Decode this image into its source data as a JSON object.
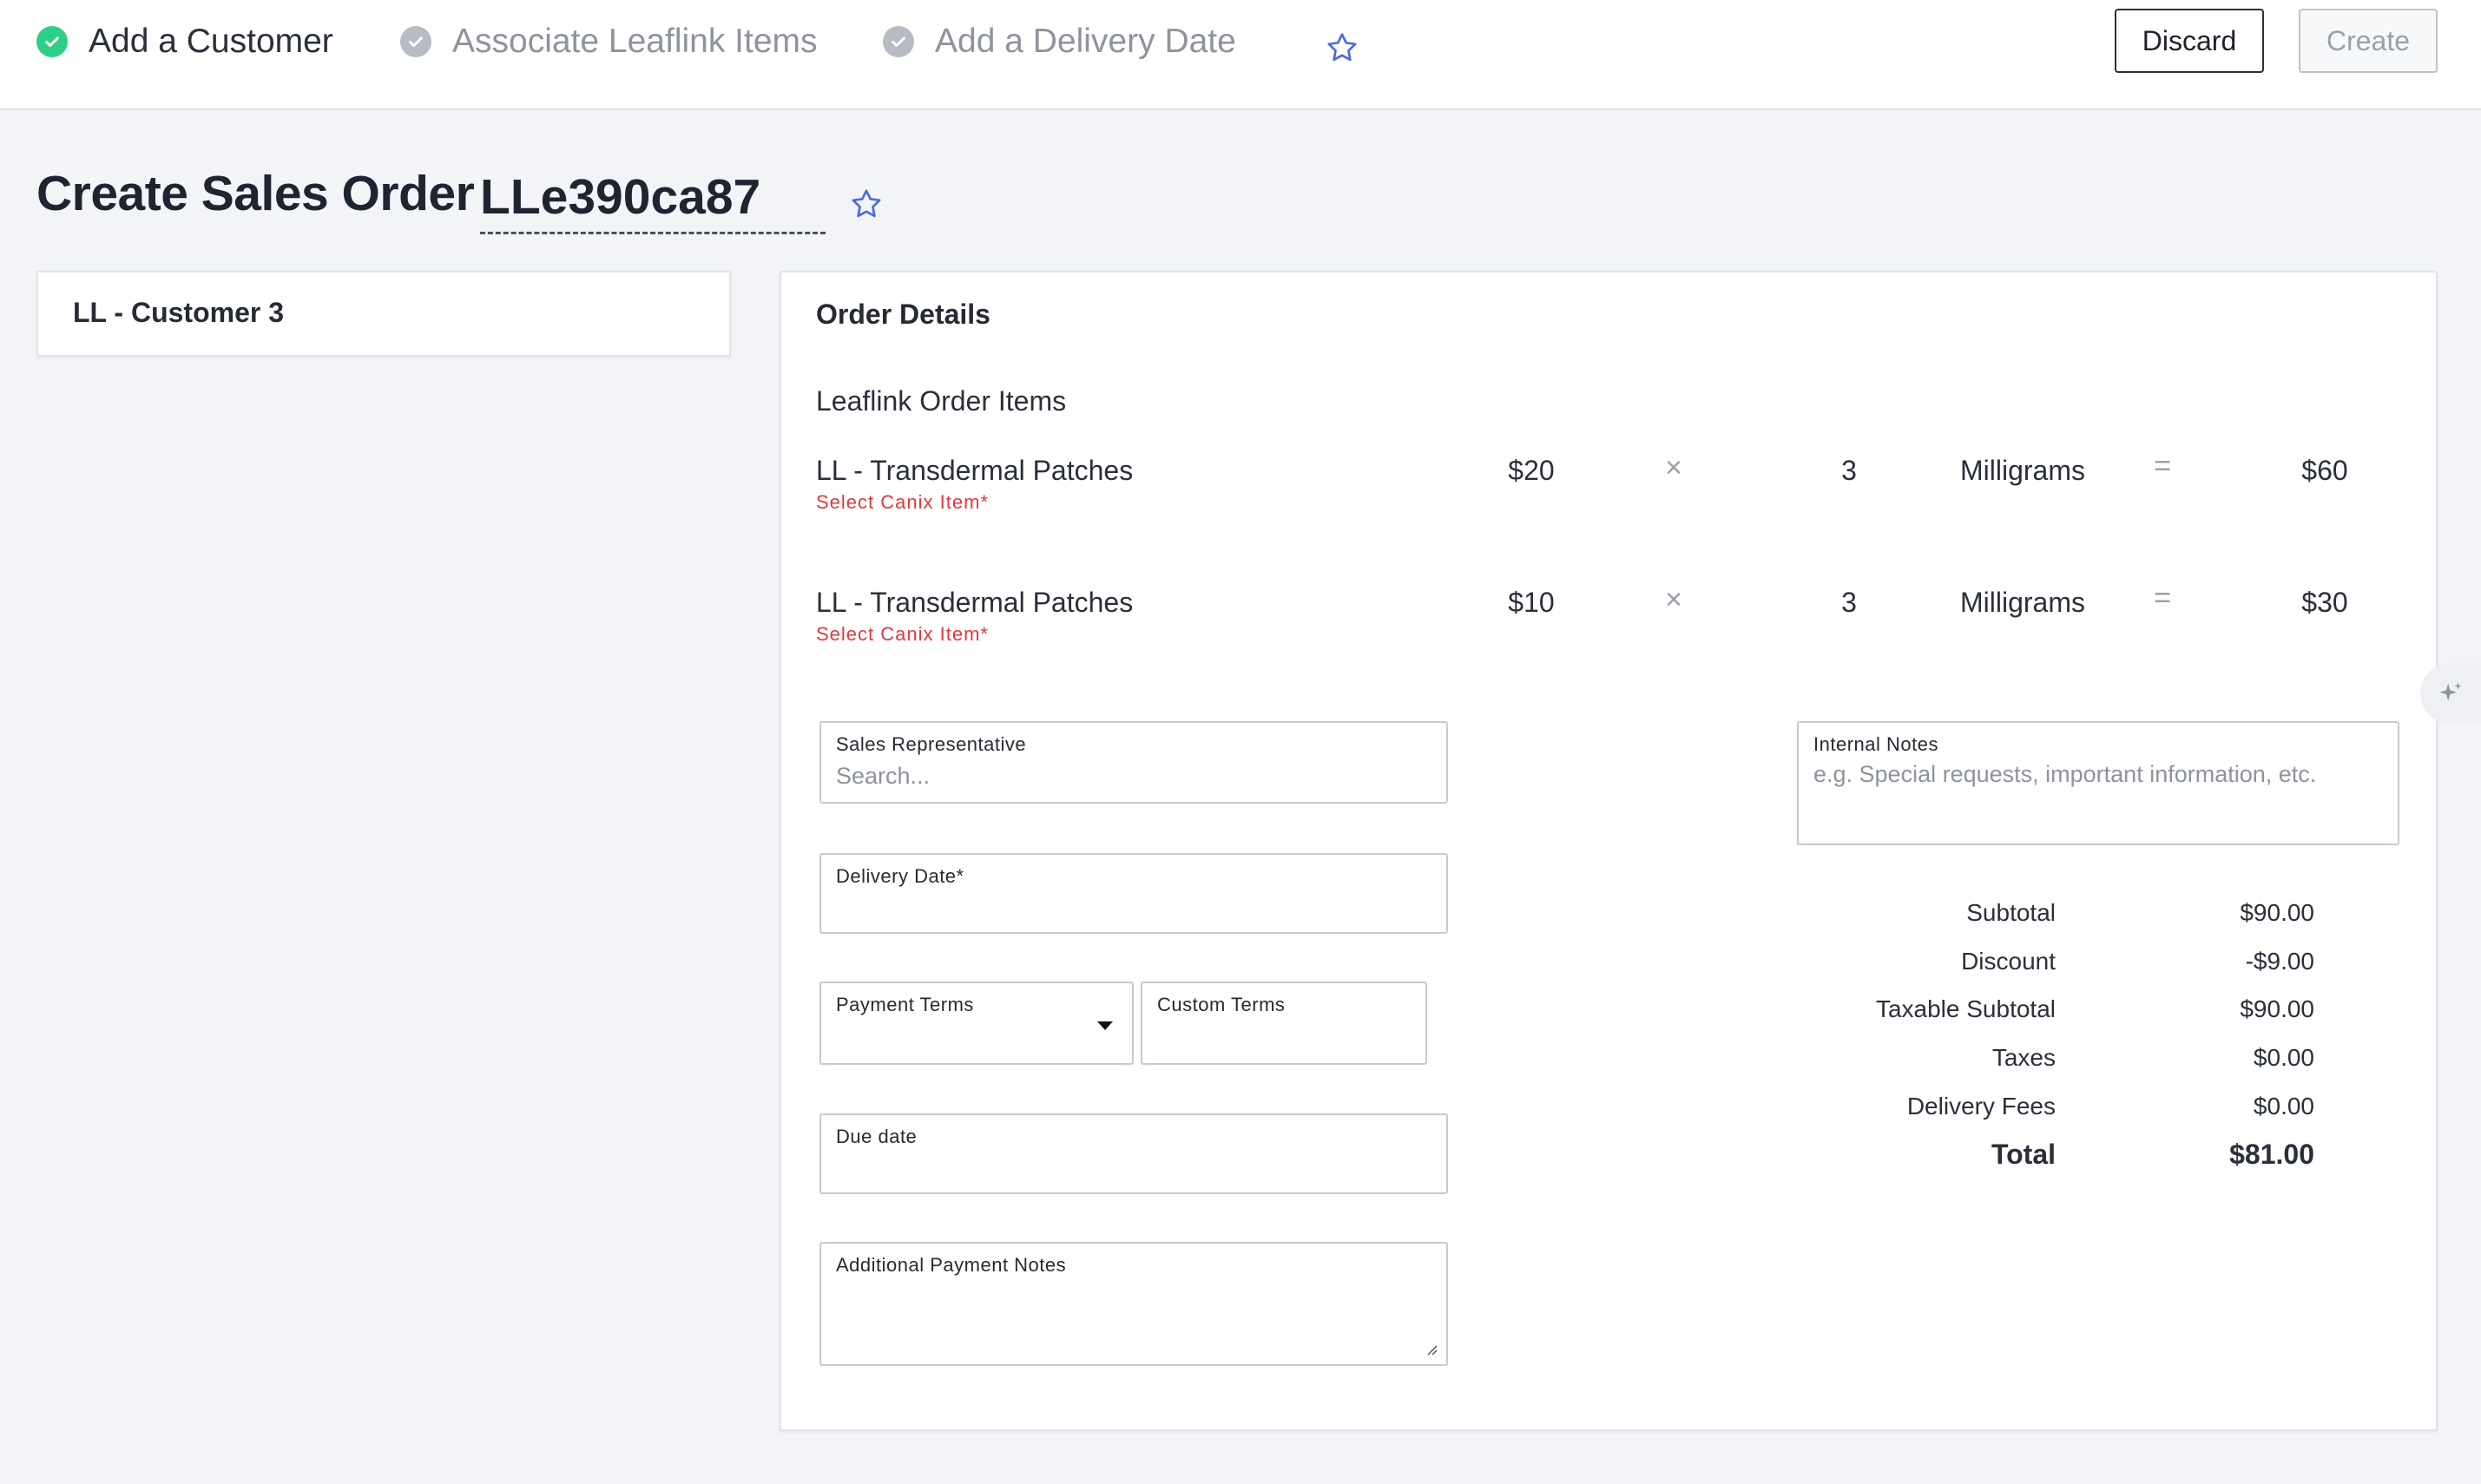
{
  "stepper": {
    "steps": [
      {
        "label": "Add a Customer",
        "state": "complete"
      },
      {
        "label": "Associate Leaflink Items",
        "state": "pending"
      },
      {
        "label": "Add a Delivery Date",
        "state": "pending"
      }
    ],
    "favorite_icon": "star-outline-icon"
  },
  "toolbar": {
    "discard_label": "Discard",
    "create_label": "Create"
  },
  "page": {
    "title": "Create Sales Order",
    "order_id": "LLe390ca87"
  },
  "customer": {
    "name": "LL - Customer 3"
  },
  "order_details": {
    "heading": "Order Details",
    "items_heading": "Leaflink Order Items",
    "items": [
      {
        "name": "LL - Transdermal Patches",
        "sub": "Select Canix Item*",
        "price": "$20",
        "times": "×",
        "qty": "3",
        "unit": "Milligrams",
        "equals": "=",
        "total": "$60"
      },
      {
        "name": "LL - Transdermal Patches",
        "sub": "Select Canix Item*",
        "price": "$10",
        "times": "×",
        "qty": "3",
        "unit": "Milligrams",
        "equals": "=",
        "total": "$30"
      }
    ]
  },
  "form": {
    "sales_rep": {
      "label": "Sales Representative",
      "placeholder": "Search..."
    },
    "delivery_date": {
      "label": "Delivery Date*",
      "value": ""
    },
    "payment_terms": {
      "label": "Payment Terms",
      "value": ""
    },
    "custom_terms": {
      "label": "Custom Terms",
      "value": ""
    },
    "due_date": {
      "label": "Due date",
      "value": ""
    },
    "additional_notes": {
      "label": "Additional Payment Notes",
      "value": ""
    },
    "internal_notes": {
      "label": "Internal Notes",
      "placeholder": "e.g. Special requests, important information, etc."
    }
  },
  "totals": [
    {
      "label": "Subtotal",
      "value": "$90.00"
    },
    {
      "label": "Discount",
      "value": "-$9.00"
    },
    {
      "label": "Taxable Subtotal",
      "value": "$90.00"
    },
    {
      "label": "Taxes",
      "value": "$0.00"
    },
    {
      "label": "Delivery Fees",
      "value": "$0.00"
    },
    {
      "label": "Total",
      "value": "$81.00"
    }
  ],
  "colors": {
    "accent_green": "#2fce88",
    "error_red": "#e0383e",
    "star_blue": "#4a6bd8",
    "background": "#f3f4f7"
  }
}
